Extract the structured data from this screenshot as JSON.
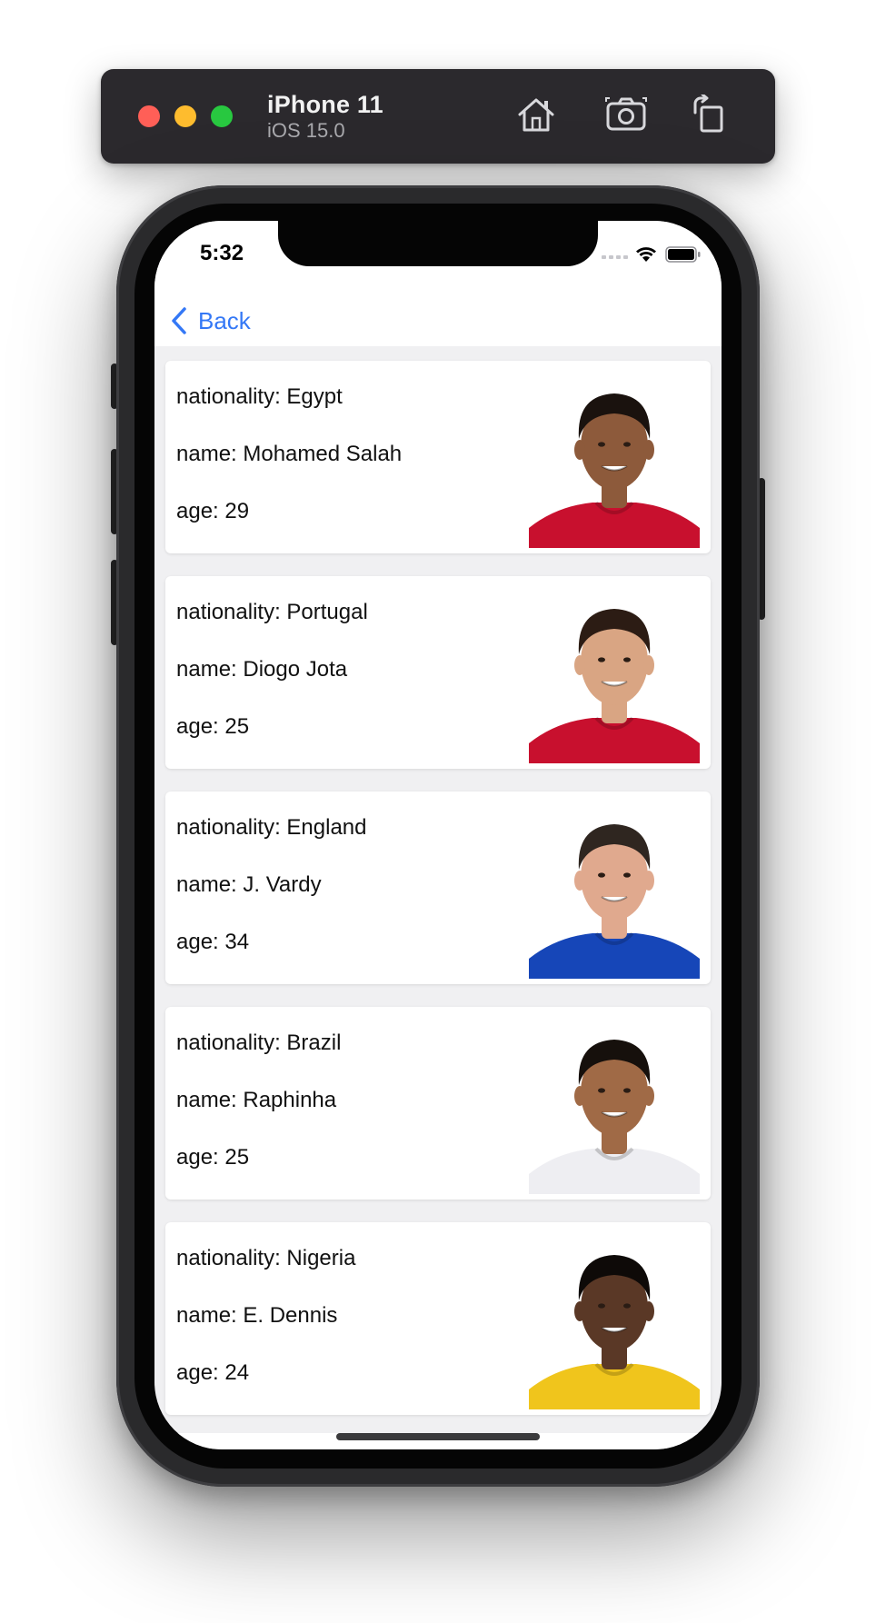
{
  "simulator": {
    "device_name": "iPhone 11",
    "os_version": "iOS 15.0",
    "buttons": [
      {
        "name": "home-icon"
      },
      {
        "name": "screenshot-icon"
      },
      {
        "name": "rotate-icon"
      }
    ]
  },
  "status_bar": {
    "time": "5:32"
  },
  "nav": {
    "back_label": "Back"
  },
  "players": [
    {
      "nationality": "nationality: Egypt",
      "name": "name: Mohamed Salah",
      "age": "age: 29",
      "kit_color": "#c8102e",
      "skin_color": "#8d5a3b",
      "hair_color": "#1a120e"
    },
    {
      "nationality": "nationality: Portugal",
      "name": "name: Diogo Jota",
      "age": "age: 25",
      "kit_color": "#c8102e",
      "skin_color": "#d9a583",
      "hair_color": "#2c1c14"
    },
    {
      "nationality": "nationality: England",
      "name": "name: J. Vardy",
      "age": "age: 34",
      "kit_color": "#1646b8",
      "skin_color": "#e0a98e",
      "hair_color": "#2f2620"
    },
    {
      "nationality": "nationality: Brazil",
      "name": "name: Raphinha",
      "age": "age: 25",
      "kit_color": "#eeeef2",
      "skin_color": "#a06a46",
      "hair_color": "#16100c"
    },
    {
      "nationality": "nationality: Nigeria",
      "name": "name: E. Dennis",
      "age": "age: 24",
      "kit_color": "#f0c51c",
      "skin_color": "#5a3826",
      "hair_color": "#0e0a08"
    }
  ],
  "colors": {
    "accent": "#3478f6",
    "screen_background": "#f0f0f2",
    "simulator_bar": "#2b292d"
  }
}
